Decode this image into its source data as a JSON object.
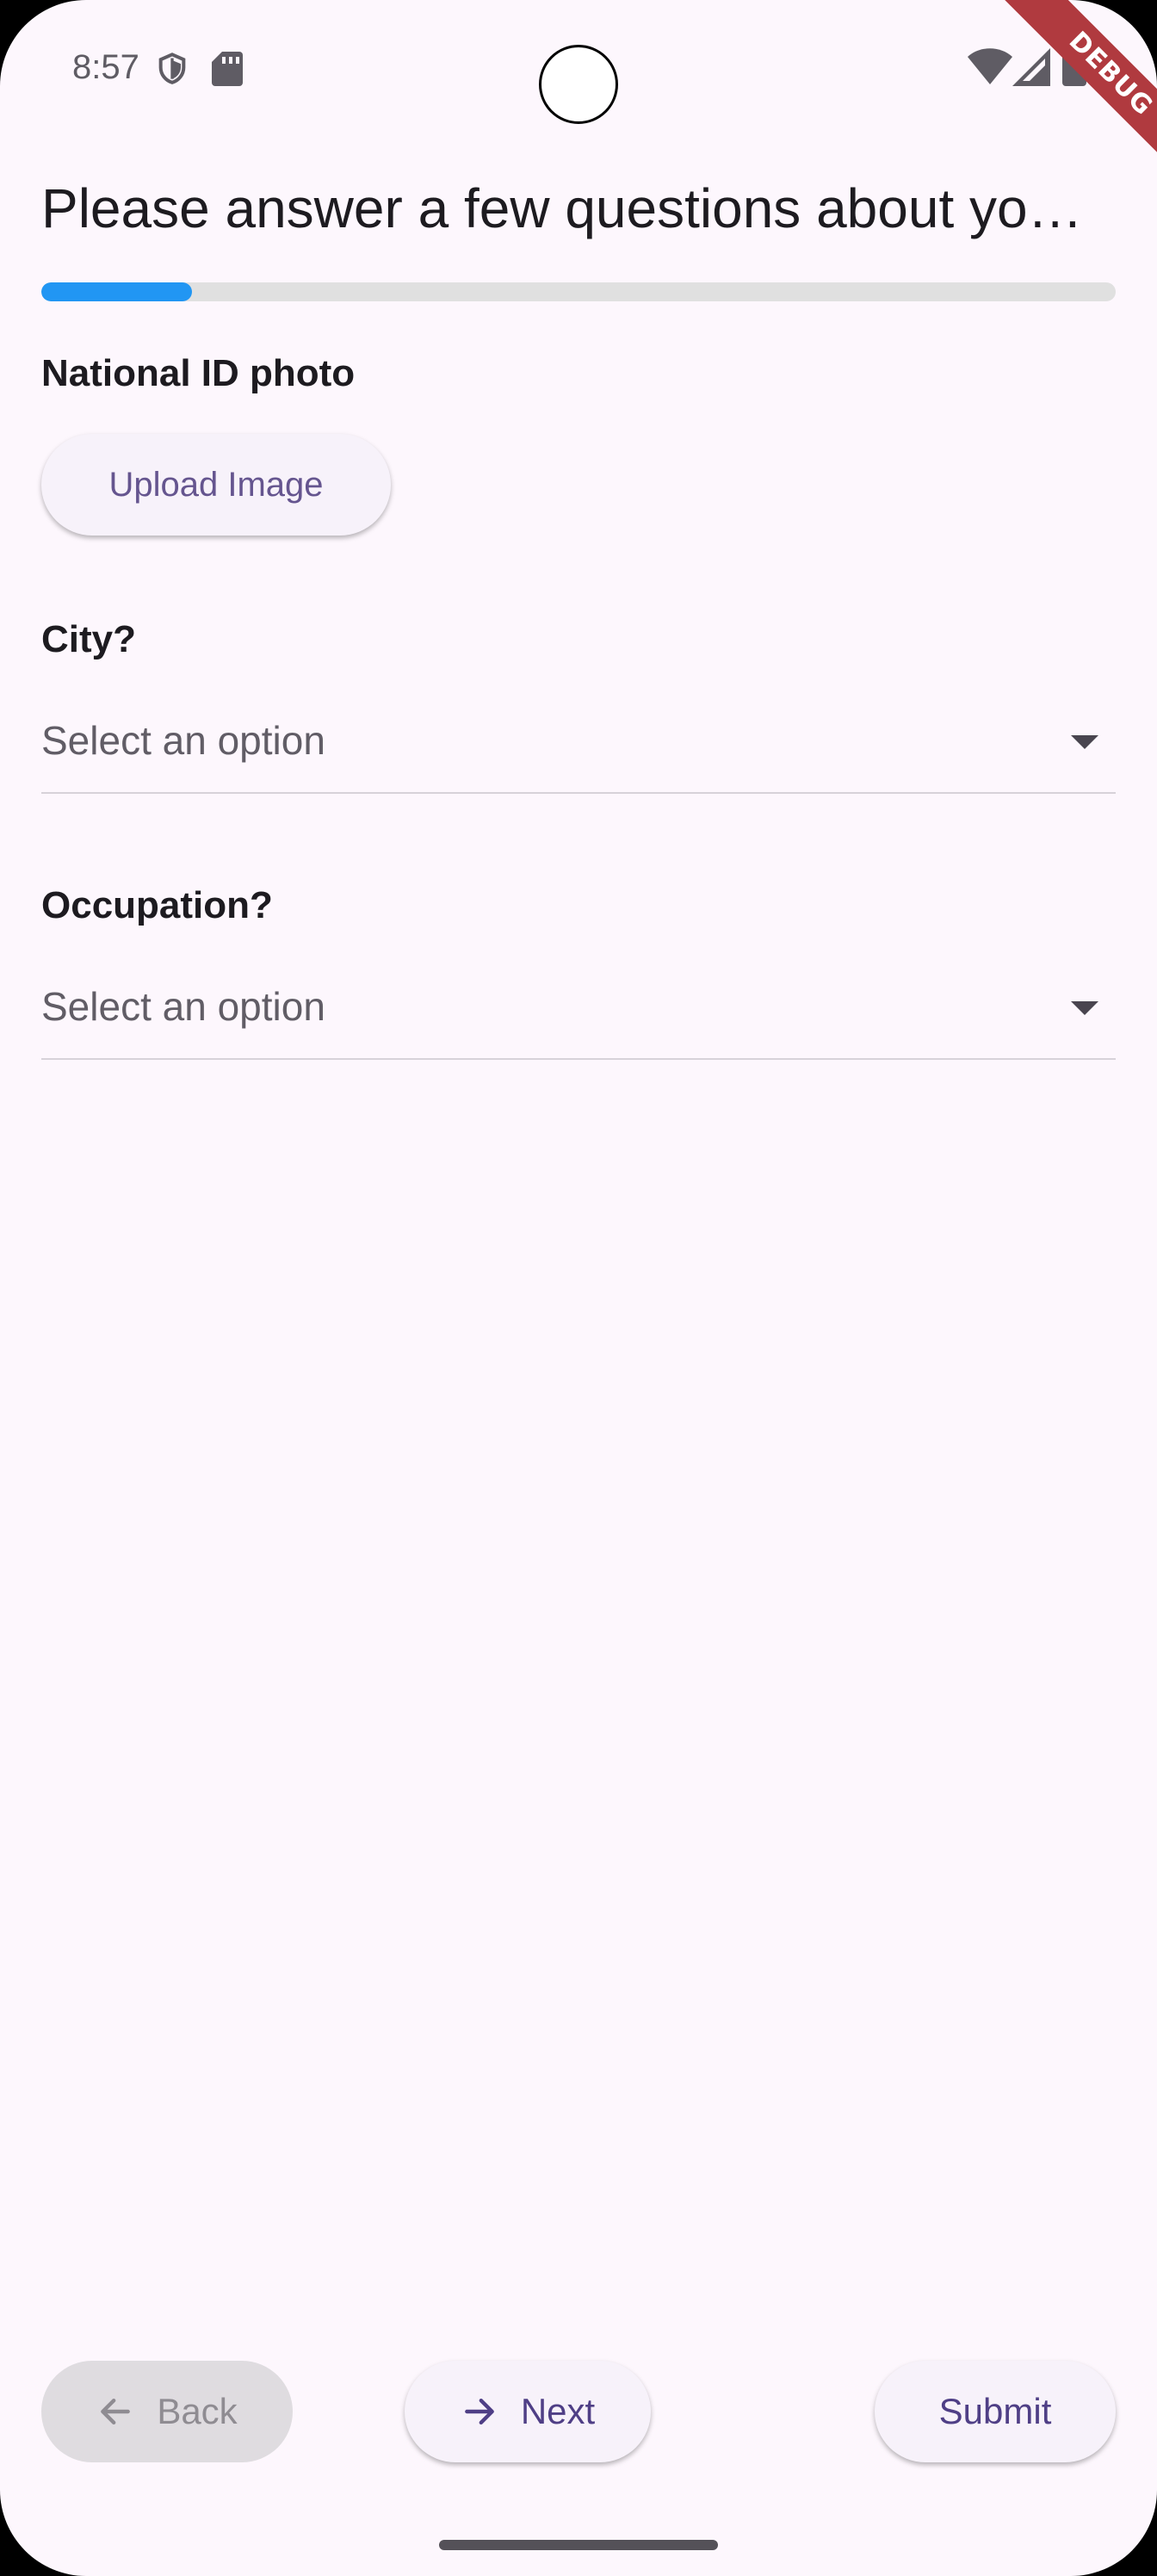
{
  "status_bar": {
    "time": "8:57"
  },
  "debug_banner": "DEBUG",
  "title": "Please answer a few questions about yo…",
  "progress": {
    "fraction": 0.14,
    "color": "#2196f3"
  },
  "questions": [
    {
      "label": "National ID photo",
      "button_label": "Upload Image"
    },
    {
      "label": "City?",
      "selected": "Select an option"
    },
    {
      "label": "Occupation?",
      "selected": "Select an option"
    }
  ],
  "footer": {
    "back_label": "Back",
    "next_label": "Next",
    "submit_label": "Submit"
  },
  "icons": {
    "status": [
      "shield-icon",
      "sd-card-icon",
      "wifi-icon",
      "cell-signal-icon",
      "battery-icon"
    ],
    "back": "arrow-left-icon",
    "next": "arrow-right-icon",
    "dropdown": "arrow-drop-down-icon"
  },
  "colors": {
    "background": "#fdf7fd",
    "accent_text": "#65558f",
    "progress_track": "#e0e0e0",
    "disabled_button": "#dfdce0",
    "debug_banner": "#b03a3f"
  }
}
